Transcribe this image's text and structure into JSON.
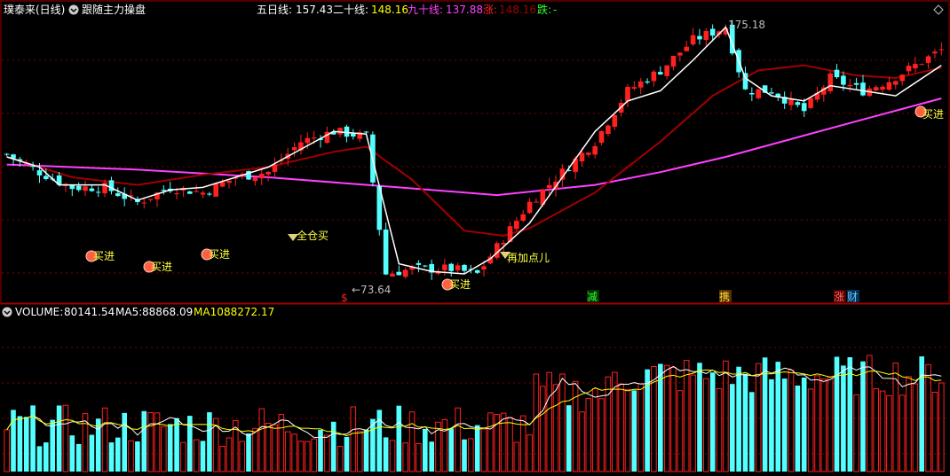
{
  "header": {
    "stock_name": "璞泰来(日线)",
    "indicator_name": "跟随主力操盘",
    "ma5_label": "五日线:",
    "ma5_value": "157.43",
    "ma20_label": "二十线:",
    "ma20_value": "148.16",
    "ma90_label": "九十线:",
    "ma90_value": "137.88",
    "up_label": "涨:",
    "up_value": "148.16",
    "down_label": "跌:",
    "down_value": "-"
  },
  "price_panel": {
    "high_marker": "175.18",
    "low_marker": "←73.64",
    "signals": [
      "买进",
      "买进",
      "买进",
      "全仓买",
      "买进",
      "再加点儿",
      "买进"
    ],
    "event_tags": [
      "$",
      "减",
      "携",
      "涨",
      "财"
    ]
  },
  "volume_panel": {
    "label": "VOLUME:",
    "value": "80141.54",
    "ma5_label": "MA5:",
    "ma5_value": "88868.09",
    "ma10_label": "MA10:",
    "ma10_value": "88272.17"
  },
  "colors": {
    "background": "#000000",
    "up": "#ff2020",
    "down": "#54ffff",
    "ma5": "#ffffff",
    "ma20": "#a00000",
    "ma90": "#ff40ff",
    "signal_green": "#33cc33",
    "signal_yellow": "#ffff40",
    "text_yellow": "#ffff00",
    "grid": "#800000"
  },
  "chart_data": {
    "type": "candlestick",
    "price_range": [
      70,
      178
    ],
    "price": {
      "points": [
        {
          "day": 0,
          "close": 125
        },
        {
          "day": 5,
          "close": 118
        },
        {
          "day": 10,
          "close": 112
        },
        {
          "day": 15,
          "close": 112
        },
        {
          "day": 20,
          "close": 106
        },
        {
          "day": 25,
          "close": 112
        },
        {
          "day": 30,
          "close": 110
        },
        {
          "day": 35,
          "close": 116
        },
        {
          "day": 40,
          "close": 118
        },
        {
          "day": 45,
          "close": 130
        },
        {
          "day": 50,
          "close": 134
        },
        {
          "day": 55,
          "close": 132
        },
        {
          "day": 58,
          "close": 78
        },
        {
          "day": 62,
          "close": 80
        },
        {
          "day": 68,
          "close": 80
        },
        {
          "day": 72,
          "close": 78
        },
        {
          "day": 76,
          "close": 92
        },
        {
          "day": 80,
          "close": 106
        },
        {
          "day": 85,
          "close": 118
        },
        {
          "day": 90,
          "close": 130
        },
        {
          "day": 95,
          "close": 150
        },
        {
          "day": 100,
          "close": 158
        },
        {
          "day": 105,
          "close": 170
        },
        {
          "day": 110,
          "close": 175
        },
        {
          "day": 113,
          "close": 150
        },
        {
          "day": 117,
          "close": 150
        },
        {
          "day": 122,
          "close": 142
        },
        {
          "day": 126,
          "close": 155
        },
        {
          "day": 131,
          "close": 150
        },
        {
          "day": 135,
          "close": 154
        },
        {
          "day": 139,
          "close": 160
        },
        {
          "day": 143,
          "close": 166
        }
      ]
    },
    "ma5": [
      {
        "day": 0,
        "value": 124
      },
      {
        "day": 5,
        "value": 120
      },
      {
        "day": 8,
        "value": 113
      },
      {
        "day": 15,
        "value": 113
      },
      {
        "day": 20,
        "value": 107
      },
      {
        "day": 25,
        "value": 111
      },
      {
        "day": 30,
        "value": 112
      },
      {
        "day": 35,
        "value": 116
      },
      {
        "day": 40,
        "value": 120
      },
      {
        "day": 45,
        "value": 127
      },
      {
        "day": 50,
        "value": 134
      },
      {
        "day": 55,
        "value": 133
      },
      {
        "day": 60,
        "value": 82
      },
      {
        "day": 65,
        "value": 79
      },
      {
        "day": 70,
        "value": 78
      },
      {
        "day": 74,
        "value": 84
      },
      {
        "day": 80,
        "value": 98
      },
      {
        "day": 85,
        "value": 116
      },
      {
        "day": 90,
        "value": 134
      },
      {
        "day": 95,
        "value": 146
      },
      {
        "day": 100,
        "value": 150
      },
      {
        "day": 105,
        "value": 162
      },
      {
        "day": 110,
        "value": 175
      },
      {
        "day": 113,
        "value": 155
      },
      {
        "day": 117,
        "value": 148
      },
      {
        "day": 122,
        "value": 146
      },
      {
        "day": 126,
        "value": 152
      },
      {
        "day": 131,
        "value": 150
      },
      {
        "day": 136,
        "value": 148
      },
      {
        "day": 143,
        "value": 160
      }
    ],
    "ma20": [
      {
        "day": 0,
        "value": 124
      },
      {
        "day": 10,
        "value": 116
      },
      {
        "day": 20,
        "value": 113
      },
      {
        "day": 30,
        "value": 117
      },
      {
        "day": 40,
        "value": 120
      },
      {
        "day": 50,
        "value": 126
      },
      {
        "day": 55,
        "value": 128
      },
      {
        "day": 62,
        "value": 115
      },
      {
        "day": 70,
        "value": 95
      },
      {
        "day": 76,
        "value": 93
      },
      {
        "day": 80,
        "value": 96
      },
      {
        "day": 90,
        "value": 110
      },
      {
        "day": 100,
        "value": 130
      },
      {
        "day": 108,
        "value": 148
      },
      {
        "day": 115,
        "value": 158
      },
      {
        "day": 122,
        "value": 160
      },
      {
        "day": 130,
        "value": 156
      },
      {
        "day": 136,
        "value": 155
      },
      {
        "day": 143,
        "value": 159
      }
    ],
    "ma90": [
      {
        "day": 0,
        "value": 121
      },
      {
        "day": 20,
        "value": 119
      },
      {
        "day": 40,
        "value": 116
      },
      {
        "day": 60,
        "value": 112
      },
      {
        "day": 75,
        "value": 109
      },
      {
        "day": 90,
        "value": 113
      },
      {
        "day": 100,
        "value": 118
      },
      {
        "day": 110,
        "value": 124
      },
      {
        "day": 120,
        "value": 131
      },
      {
        "day": 130,
        "value": 138
      },
      {
        "day": 143,
        "value": 147
      }
    ],
    "volume": {
      "range": [
        0,
        180000
      ],
      "ma5_series": "88868.09",
      "ma10_series": "88272.17"
    }
  }
}
